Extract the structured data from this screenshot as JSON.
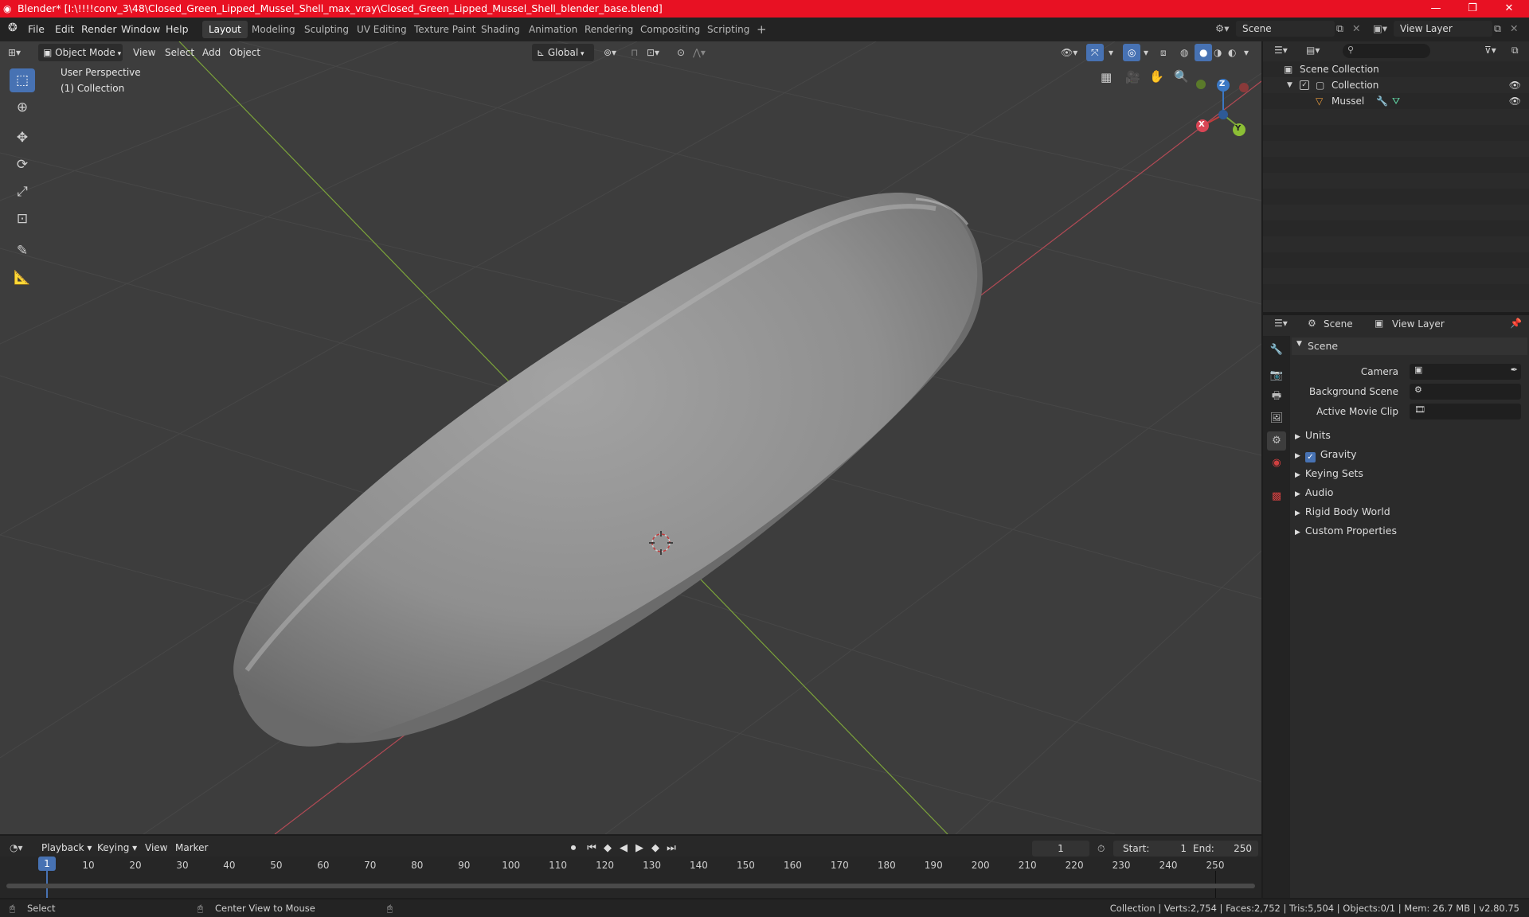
{
  "window": {
    "title": "Blender* [I:\\!!!!conv_3\\48\\Closed_Green_Lipped_Mussel_Shell_max_vray\\Closed_Green_Lipped_Mussel_Shell_blender_base.blend]",
    "controls": [
      "—",
      "❐",
      "✕"
    ]
  },
  "menubar": {
    "menus": [
      "File",
      "Edit",
      "Render",
      "Window",
      "Help"
    ],
    "workspaces": [
      "Layout",
      "Modeling",
      "Sculpting",
      "UV Editing",
      "Texture Paint",
      "Shading",
      "Animation",
      "Rendering",
      "Compositing",
      "Scripting"
    ],
    "add_workspace": "+",
    "scene": "Scene",
    "view_layer": "View Layer"
  },
  "viewport": {
    "mode": "Object Mode",
    "menus": [
      "View",
      "Select",
      "Add",
      "Object"
    ],
    "orientation": "Global",
    "perspective_label": "User Perspective",
    "collection_label": "(1) Collection",
    "gizmo": {
      "x": "X",
      "y": "Y",
      "z": "Z"
    },
    "colors": {
      "bg": "#3d3d3d",
      "grid": "#484848",
      "x_axis": "#b34a55",
      "y_axis": "#7ba33a",
      "active_tool": "#4772b3"
    }
  },
  "outliner": {
    "search_placeholder": "",
    "root": "Scene Collection",
    "collection": "Collection",
    "object": "Mussel"
  },
  "properties": {
    "tabs": [
      "Scene",
      "View Layer"
    ],
    "panel_title": "Scene",
    "fields": [
      {
        "label": "Camera",
        "value": ""
      },
      {
        "label": "Background Scene",
        "value": ""
      },
      {
        "label": "Active Movie Clip",
        "value": ""
      }
    ],
    "sections": [
      "Units",
      "Gravity",
      "Keying Sets",
      "Audio",
      "Rigid Body World",
      "Custom Properties"
    ],
    "gravity_checked": true
  },
  "timeline": {
    "menus": [
      "Playback",
      "Keying",
      "View",
      "Marker"
    ],
    "current_frame": "1",
    "start_label": "Start:",
    "start": "1",
    "end_label": "End:",
    "end": "250",
    "ticks": [
      "1",
      "10",
      "20",
      "30",
      "40",
      "50",
      "60",
      "70",
      "80",
      "90",
      "100",
      "110",
      "120",
      "130",
      "140",
      "150",
      "160",
      "170",
      "180",
      "190",
      "200",
      "210",
      "220",
      "230",
      "240",
      "250"
    ]
  },
  "statusbar": {
    "left_hint": "Select",
    "middle_hint": "Center View to Mouse",
    "stats": "Collection | Verts:2,754 | Faces:2,752 | Tris:5,504 | Objects:0/1 | Mem: 26.7 MB | v2.80.75"
  }
}
